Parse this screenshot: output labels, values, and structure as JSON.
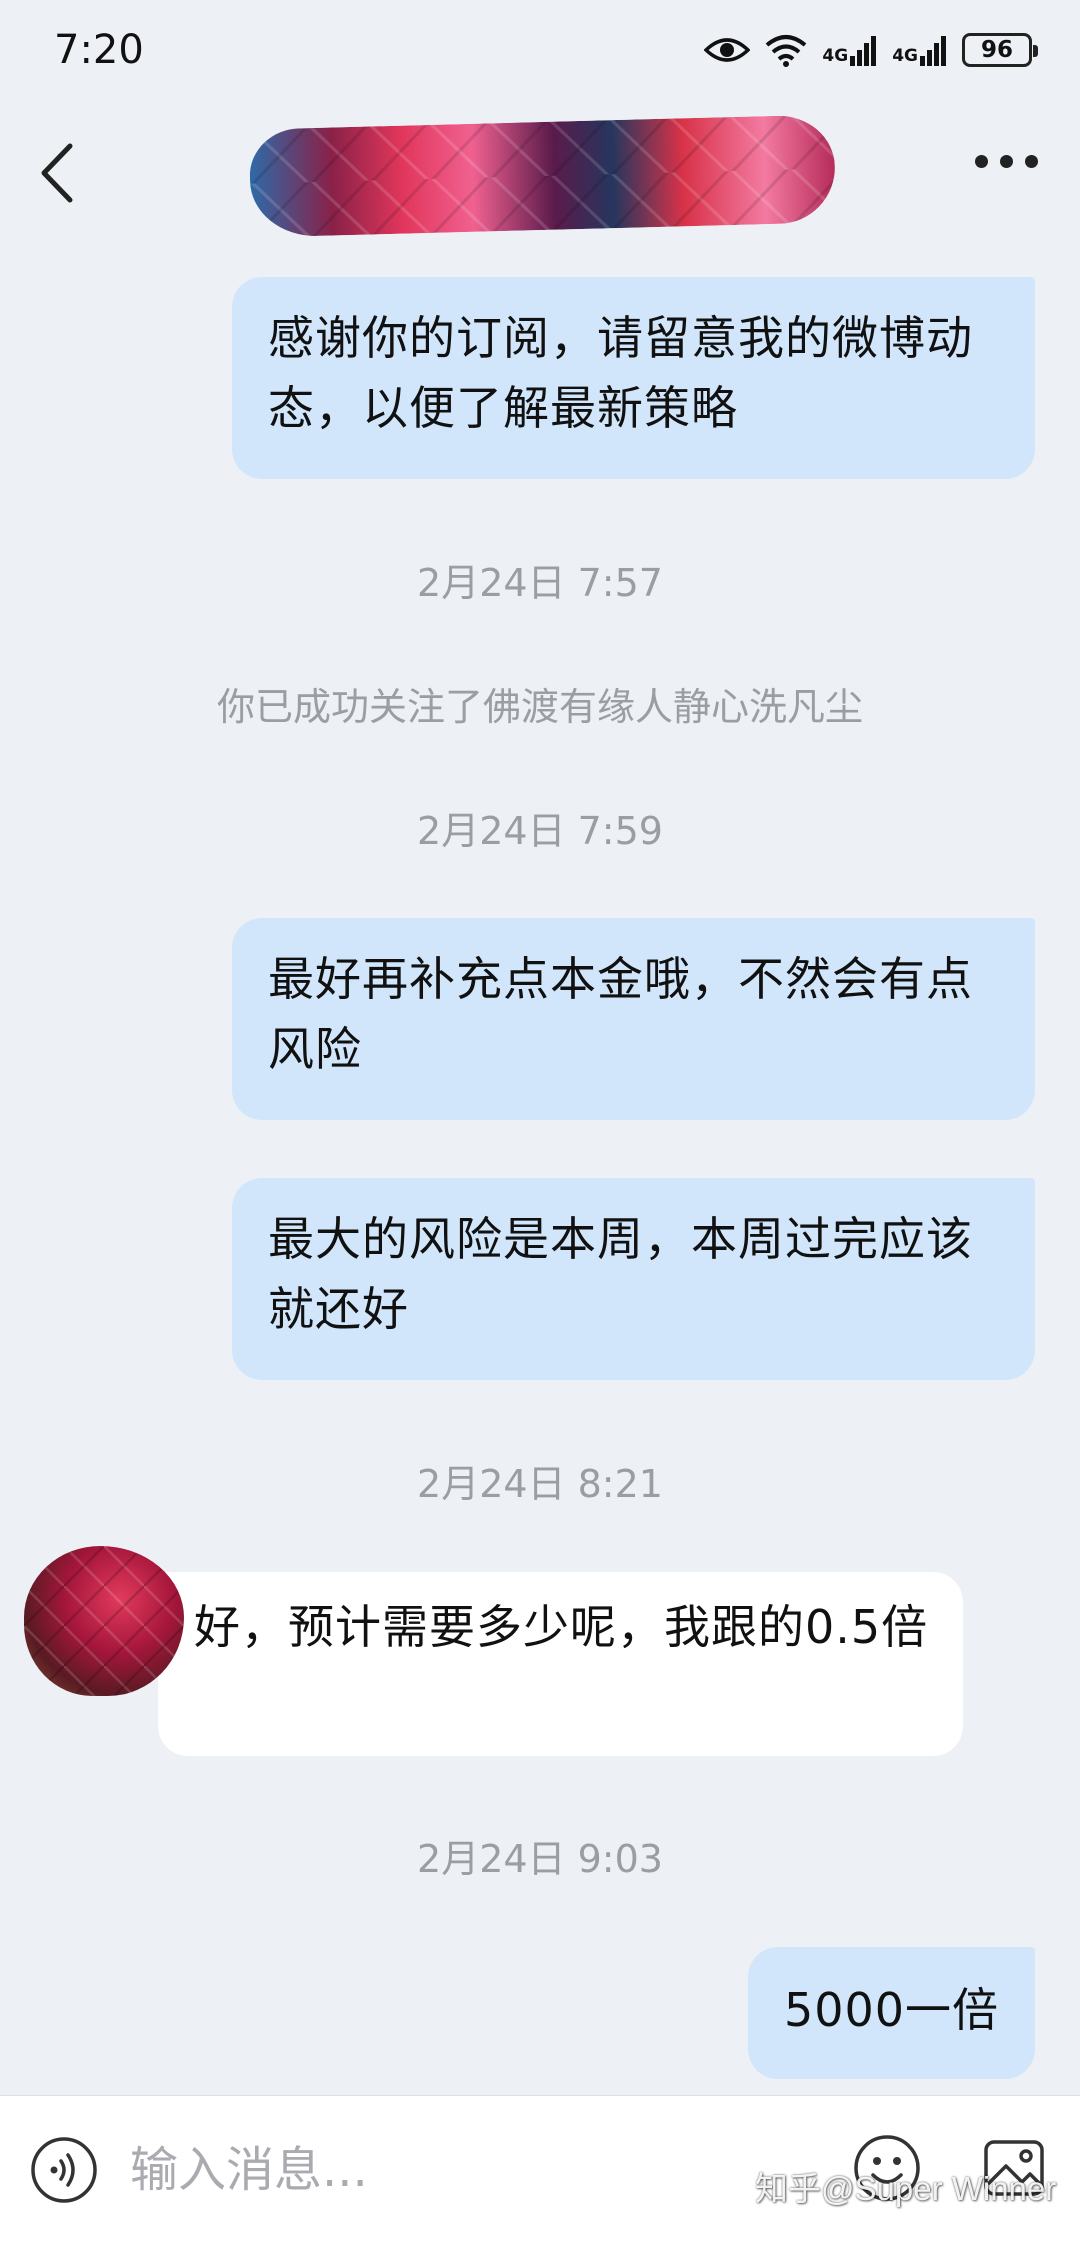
{
  "status_bar": {
    "time": "7:20",
    "network_1": "4G",
    "network_2": "4G",
    "battery": "96"
  },
  "nav": {
    "icons": {
      "back": "chevron-left-icon",
      "more": "more-dots-icon"
    }
  },
  "messages": [
    {
      "type": "sent",
      "text": "感谢你的订阅，请留意我的微博动态，以便了解最新策略"
    },
    {
      "type": "timestamp",
      "text": "2月24日 7:57"
    },
    {
      "type": "system",
      "text": "你已成功关注了佛渡有缘人静心洗凡尘"
    },
    {
      "type": "timestamp",
      "text": "2月24日 7:59"
    },
    {
      "type": "sent",
      "text": "最好再补充点本金哦，不然会有点风险"
    },
    {
      "type": "sent",
      "text": "最大的风险是本周，本周过完应该就还好"
    },
    {
      "type": "timestamp",
      "text": "2月24日 8:21"
    },
    {
      "type": "received",
      "text": "好，预计需要多少呢，我跟的0.5倍"
    },
    {
      "type": "timestamp",
      "text": "2月24日 9:03"
    },
    {
      "type": "sent",
      "text": "5000一倍"
    }
  ],
  "input_bar": {
    "placeholder": "输入消息...",
    "icons": {
      "voice": "voice-icon",
      "emoji": "emoji-icon",
      "image": "image-icon"
    }
  },
  "watermark": "知乎@Super Winner",
  "colors": {
    "background": "#edf0f5",
    "sent_bubble": "#d2e6fb",
    "received_bubble": "#ffffff",
    "meta_text": "#9a9da3"
  }
}
